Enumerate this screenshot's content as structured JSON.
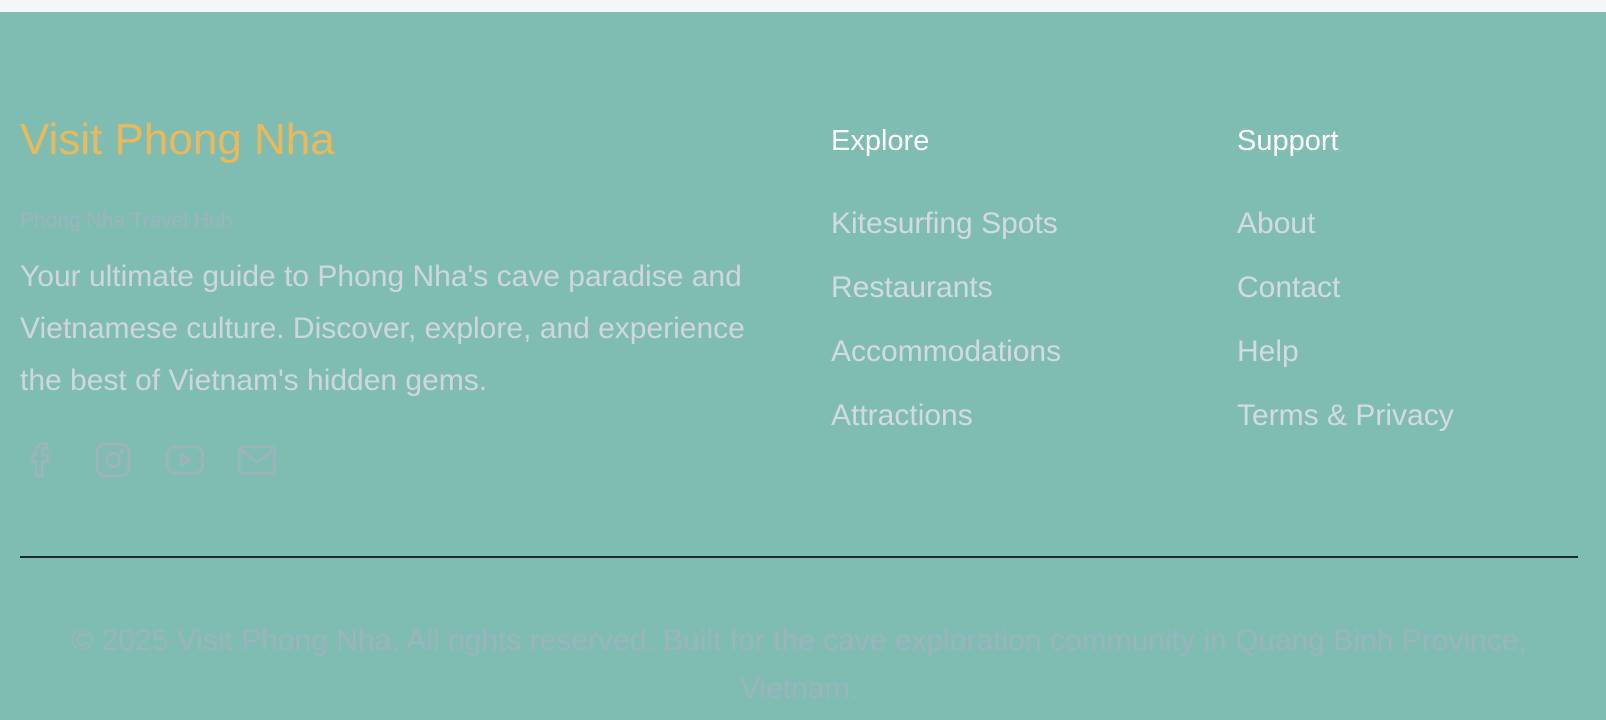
{
  "brand": {
    "title": "Visit Phong Nha",
    "tagline": "Phong Nha Travel Hub",
    "description": "Your ultimate guide to Phong Nha's cave paradise and Vietnamese culture. Discover, explore, and experience the best of Vietnam's hidden gems."
  },
  "socials": [
    {
      "icon": "facebook-icon"
    },
    {
      "icon": "instagram-icon"
    },
    {
      "icon": "youtube-icon"
    },
    {
      "icon": "mail-icon"
    }
  ],
  "explore": {
    "heading": "Explore",
    "links": [
      "Kitesurfing Spots",
      "Restaurants",
      "Accommodations",
      "Attractions"
    ]
  },
  "support": {
    "heading": "Support",
    "links": [
      "About",
      "Contact",
      "Help",
      "Terms & Privacy"
    ]
  },
  "copyright": "© 2025 Visit Phong Nha. All rights reserved. Built for the cave exploration community in Quang Binh Province, Vietnam.",
  "colors": {
    "footer_bg": "#7fbdb2",
    "brand_accent": "#ecb95a",
    "heading": "#ffffff",
    "link": "#d3dbe0",
    "muted": "#9cb4bd",
    "divider": "#1f2a2e"
  }
}
